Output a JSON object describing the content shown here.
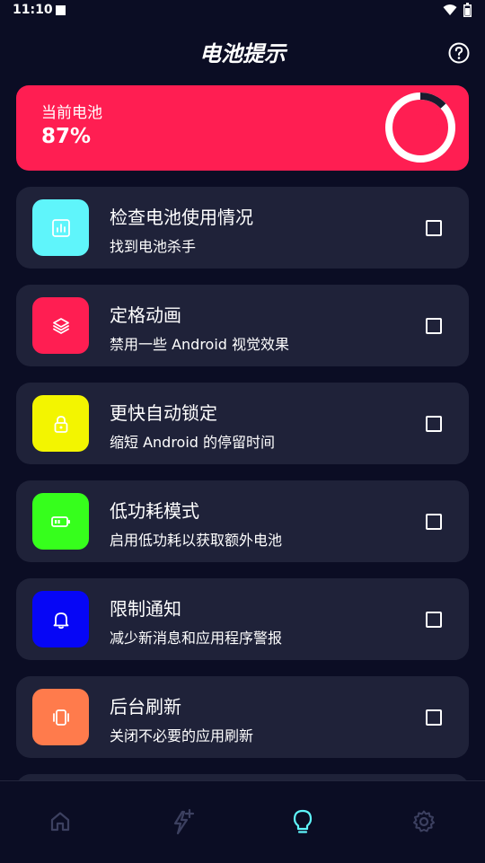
{
  "status_bar": {
    "time": "11:10"
  },
  "header": {
    "title": "电池提示",
    "help_icon": "help-circle-icon"
  },
  "battery": {
    "label": "当前电池",
    "percent_text": "87%",
    "level_fraction": 0.87,
    "card_color": "#ff1e52"
  },
  "tips": [
    {
      "title": "检查电池使用情况",
      "subtitle": "找到电池杀手",
      "icon": "chart-icon",
      "color": "#5ff5fb",
      "checked": false
    },
    {
      "title": "定格动画",
      "subtitle": "禁用一些 Android 视觉效果",
      "icon": "layers-icon",
      "color": "#ff1e52",
      "checked": false
    },
    {
      "title": "更快自动锁定",
      "subtitle": "缩短 Android 的停留时间",
      "icon": "lock-icon",
      "color": "#f3f500",
      "checked": false
    },
    {
      "title": "低功耗模式",
      "subtitle": "启用低功耗以获取额外电池",
      "icon": "battery-low-icon",
      "color": "#36ff1c",
      "checked": false
    },
    {
      "title": "限制通知",
      "subtitle": "减少新消息和应用程序警报",
      "icon": "bell-icon",
      "color": "#0606f6",
      "checked": false
    },
    {
      "title": "后台刷新",
      "subtitle": "关闭不必要的应用刷新",
      "icon": "vibrate-icon",
      "color": "#ff7b4c",
      "checked": false
    }
  ],
  "bottom_nav": {
    "items": [
      {
        "icon": "home-icon",
        "active": false
      },
      {
        "icon": "flash-icon",
        "active": false
      },
      {
        "icon": "lightbulb-icon",
        "active": true
      },
      {
        "icon": "gear-icon",
        "active": false
      }
    ],
    "active_color": "#5ff5fb",
    "inactive_color": "#3c4060"
  }
}
